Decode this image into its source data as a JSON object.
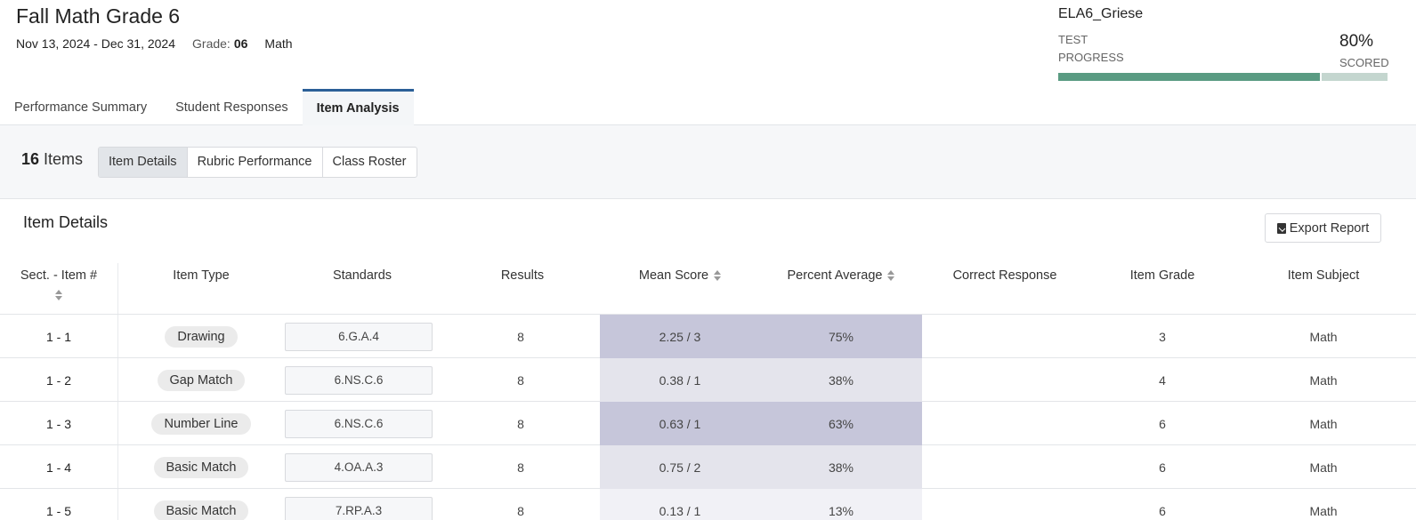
{
  "header": {
    "title": "Fall Math Grade 6",
    "date_range": "Nov 13, 2024 - Dec 31, 2024",
    "grade_label": "Grade:",
    "grade_value": "06",
    "subject": "Math",
    "class_name": "ELA6_Griese",
    "progress_label": "TEST PROGRESS",
    "progress_percent": "80%",
    "progress_value": 0.8,
    "progress_scored_label": "SCORED"
  },
  "tabs": [
    {
      "label": "Performance Summary",
      "active": false
    },
    {
      "label": "Student Responses",
      "active": false
    },
    {
      "label": "Item Analysis",
      "active": true
    }
  ],
  "subbar": {
    "count": "16",
    "count_label": "Items",
    "views": [
      {
        "label": "Item Details",
        "active": true
      },
      {
        "label": "Rubric Performance",
        "active": false
      },
      {
        "label": "Class Roster",
        "active": false
      }
    ]
  },
  "section": {
    "title": "Item Details",
    "export_label": "Export Report"
  },
  "table": {
    "headers": {
      "sect": "Sect. - Item #",
      "type": "Item Type",
      "standards": "Standards",
      "results": "Results",
      "mean": "Mean Score",
      "pct": "Percent Average",
      "correct": "Correct Response",
      "grade": "Item Grade",
      "subject": "Item Subject"
    },
    "rows": [
      {
        "sect": "1 - 1",
        "type": "Drawing",
        "standard": "6.G.A.4",
        "results": "8",
        "mean": "2.25 / 3",
        "pct": "75%",
        "correct": "",
        "grade": "3",
        "subject": "Math",
        "shade": "dark"
      },
      {
        "sect": "1 - 2",
        "type": "Gap Match",
        "standard": "6.NS.C.6",
        "results": "8",
        "mean": "0.38 / 1",
        "pct": "38%",
        "correct": "",
        "grade": "4",
        "subject": "Math",
        "shade": "light"
      },
      {
        "sect": "1 - 3",
        "type": "Number Line",
        "standard": "6.NS.C.6",
        "results": "8",
        "mean": "0.63 / 1",
        "pct": "63%",
        "correct": "",
        "grade": "6",
        "subject": "Math",
        "shade": "dark"
      },
      {
        "sect": "1 - 4",
        "type": "Basic Match",
        "standard": "4.OA.A.3",
        "results": "8",
        "mean": "0.75 / 2",
        "pct": "38%",
        "correct": "",
        "grade": "6",
        "subject": "Math",
        "shade": "light"
      },
      {
        "sect": "1 - 5",
        "type": "Basic Match",
        "standard": "7.RP.A.3",
        "results": "8",
        "mean": "0.13 / 1",
        "pct": "13%",
        "correct": "",
        "grade": "6",
        "subject": "Math",
        "shade": "faint"
      }
    ]
  }
}
